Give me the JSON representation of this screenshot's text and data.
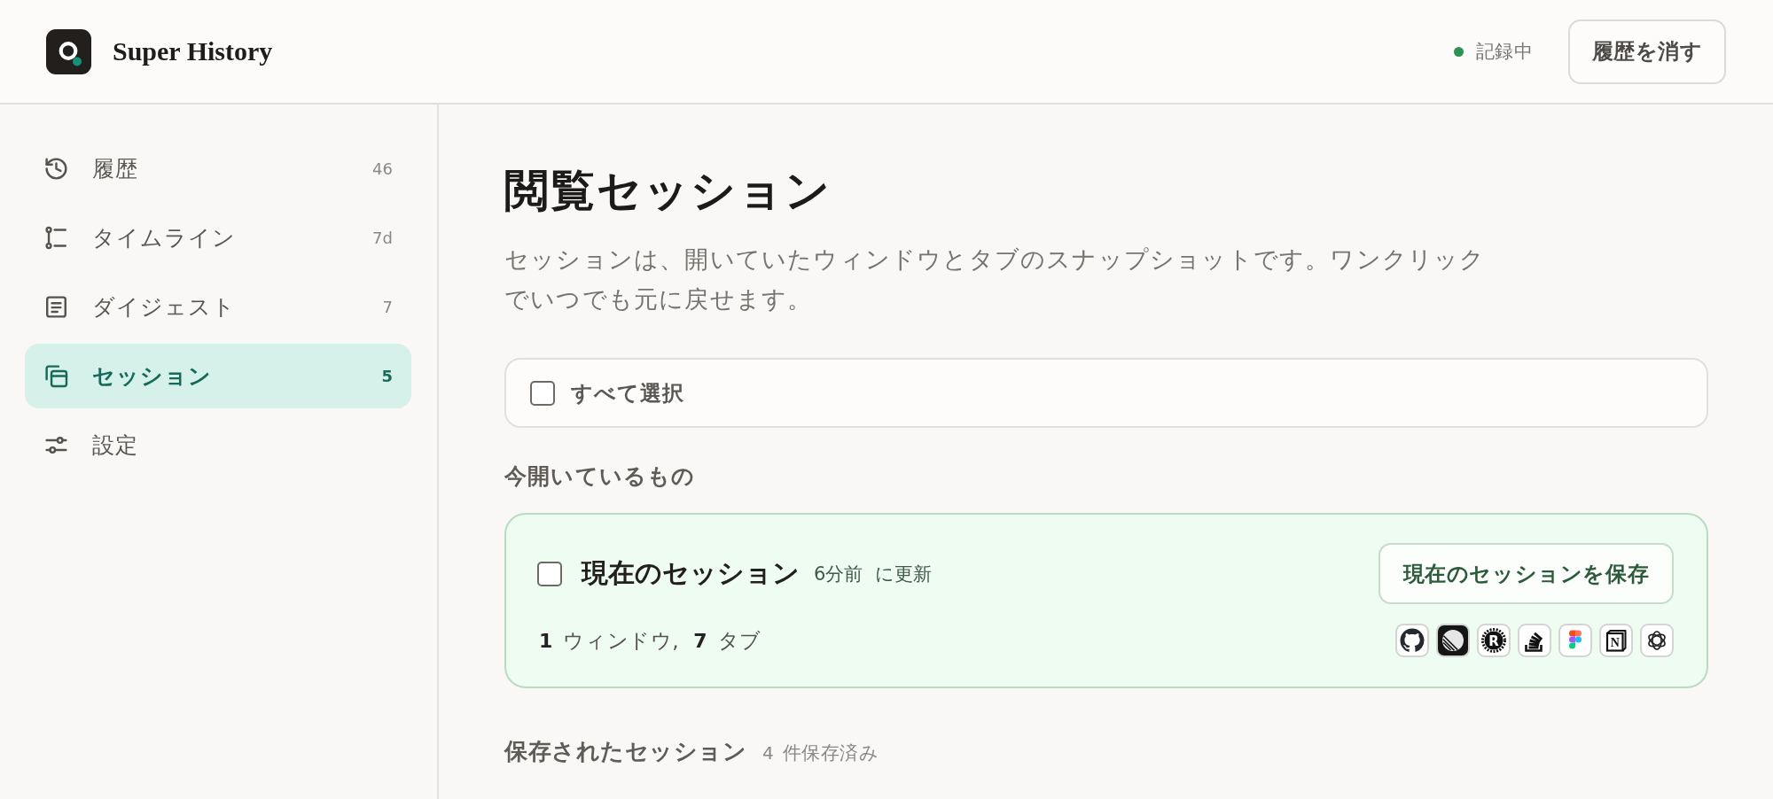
{
  "header": {
    "app_name": "Super History",
    "recording": {
      "label": "記録中",
      "on": true
    },
    "clear_button": "履歴を消す"
  },
  "sidebar": {
    "items": [
      {
        "kind": "history",
        "label": "履歴",
        "count": "46",
        "selected": false
      },
      {
        "kind": "timeline",
        "label": "タイムライン",
        "count": "7d",
        "selected": false
      },
      {
        "kind": "digest",
        "label": "ダイジェスト",
        "count": "7",
        "selected": false
      },
      {
        "kind": "sessions",
        "label": "セッション",
        "count": "5",
        "selected": true
      },
      {
        "kind": "settings",
        "label": "設定",
        "selected": false
      }
    ]
  },
  "main": {
    "title": "閲覧セッション",
    "description": "セッションは、開いていたウィンドウとタブのスナップショットです。ワンクリックでいつでも元に戻せます。",
    "select_all": {
      "label": "すべて選択",
      "checked": false
    },
    "current_section": {
      "heading": "今開いているもの",
      "session": {
        "title": "現在のセッション",
        "checked": false,
        "updated_time": "6分前",
        "updated_suffix": "に更新",
        "save_button": "現在のセッションを保存",
        "windows_count": "1",
        "windows_label": "ウィンドウ,",
        "tabs_count": "7",
        "tabs_label": "タブ",
        "favicons": [
          {
            "kind": "cat"
          },
          {
            "kind": "striped-circle"
          },
          {
            "kind": "gear-letter",
            "letter": "R"
          },
          {
            "kind": "stacked-bars"
          },
          {
            "kind": "colored-shapes"
          },
          {
            "kind": "letter-cube",
            "letter": "N"
          },
          {
            "kind": "knot"
          }
        ]
      }
    },
    "saved_section": {
      "heading": "保存されたセッション",
      "count": "4",
      "count_label": "件保存済み"
    }
  }
}
